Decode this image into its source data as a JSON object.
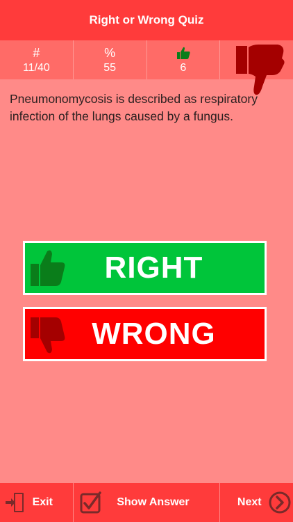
{
  "header": {
    "title": "Right or Wrong Quiz"
  },
  "stats": {
    "count": {
      "icon": "#",
      "value": "11/40"
    },
    "percent": {
      "icon": "%",
      "value": "55"
    },
    "correct": {
      "icon_name": "thumbs-up-icon",
      "value": "6"
    },
    "wrong": {
      "icon_name": "thumbs-down-icon"
    }
  },
  "question": {
    "text": "Pneumonomycosis is described as respiratory infection of the lungs caused by a fungus."
  },
  "answers": {
    "right_label": "RIGHT",
    "wrong_label": "WRONG"
  },
  "footer": {
    "exit_label": "Exit",
    "show_answer_label": "Show Answer",
    "next_label": "Next"
  },
  "colors": {
    "header": "#ff3b3b",
    "background": "#ff8a88",
    "right": "#00c53a",
    "wrong": "#ff0000",
    "thumb_up": "#0a7d1a",
    "thumb_down": "#a40000"
  }
}
